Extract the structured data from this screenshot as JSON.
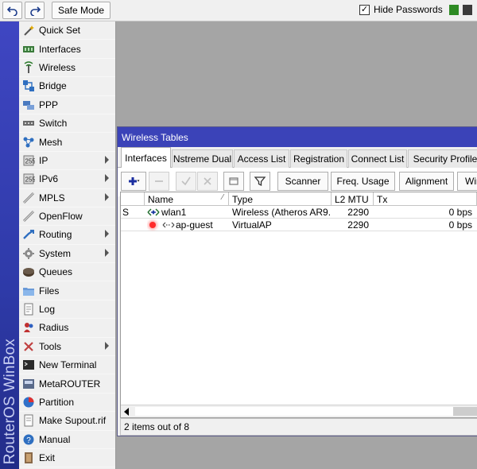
{
  "toolbar": {
    "undo_icon": "undo-icon",
    "redo_icon": "redo-icon",
    "safe_mode_label": "Safe Mode",
    "hide_passwords_label": "Hide Passwords",
    "hide_passwords_checked": "✓",
    "status_colors": [
      "#2e8b24",
      "#3b3b3b"
    ]
  },
  "brand": {
    "text": "RouterOS WinBox",
    "color": "#3b43b8"
  },
  "menu": {
    "items": [
      {
        "label": "Quick Set",
        "icon": "wand-icon",
        "submenu": false
      },
      {
        "label": "Interfaces",
        "icon": "interfaces-icon",
        "submenu": false
      },
      {
        "label": "Wireless",
        "icon": "antenna-icon",
        "submenu": false
      },
      {
        "label": "Bridge",
        "icon": "bridge-icon",
        "submenu": false
      },
      {
        "label": "PPP",
        "icon": "ppp-icon",
        "submenu": false
      },
      {
        "label": "Switch",
        "icon": "switch-icon",
        "submenu": false
      },
      {
        "label": "Mesh",
        "icon": "mesh-icon",
        "submenu": false
      },
      {
        "label": "IP",
        "icon": "ip-icon",
        "submenu": true
      },
      {
        "label": "IPv6",
        "icon": "ipv6-icon",
        "submenu": true
      },
      {
        "label": "MPLS",
        "icon": "mpls-icon",
        "submenu": true
      },
      {
        "label": "OpenFlow",
        "icon": "openflow-icon",
        "submenu": false
      },
      {
        "label": "Routing",
        "icon": "routing-icon",
        "submenu": true
      },
      {
        "label": "System",
        "icon": "gear-icon",
        "submenu": true
      },
      {
        "label": "Queues",
        "icon": "queues-icon",
        "submenu": false
      },
      {
        "label": "Files",
        "icon": "folder-icon",
        "submenu": false
      },
      {
        "label": "Log",
        "icon": "log-icon",
        "submenu": false
      },
      {
        "label": "Radius",
        "icon": "radius-icon",
        "submenu": false
      },
      {
        "label": "Tools",
        "icon": "tools-icon",
        "submenu": true
      },
      {
        "label": "New Terminal",
        "icon": "terminal-icon",
        "submenu": false
      },
      {
        "label": "MetaROUTER",
        "icon": "metarouter-icon",
        "submenu": false
      },
      {
        "label": "Partition",
        "icon": "partition-icon",
        "submenu": false
      },
      {
        "label": "Make Supout.rif",
        "icon": "supout-icon",
        "submenu": false
      },
      {
        "label": "Manual",
        "icon": "help-icon",
        "submenu": false
      },
      {
        "label": "Exit",
        "icon": "exit-icon",
        "submenu": false
      }
    ]
  },
  "window": {
    "title": "Wireless Tables",
    "tabs": [
      {
        "label": "Interfaces",
        "active": true
      },
      {
        "label": "Nstreme Dual",
        "active": false
      },
      {
        "label": "Access List",
        "active": false
      },
      {
        "label": "Registration",
        "active": false
      },
      {
        "label": "Connect List",
        "active": false
      },
      {
        "label": "Security Profiles",
        "active": false
      }
    ],
    "actions": {
      "add_icon": "plus-icon",
      "remove_icon": "minus-icon",
      "enable_icon": "check-icon",
      "disable_icon": "x-icon",
      "comment_icon": "comment-icon",
      "filter_icon": "filter-icon",
      "scanner_label": "Scanner",
      "freq_usage_label": "Freq. Usage",
      "alignment_label": "Alignment",
      "more_label": "Wir"
    },
    "table": {
      "headers": {
        "flags": "",
        "name": "Name",
        "type": "Type",
        "l2mtu": "L2 MTU",
        "tx": "Tx"
      },
      "rows": [
        {
          "flag": "S",
          "name": "wlan1",
          "type": "Wireless (Atheros AR9...",
          "l2mtu": "2290",
          "tx": "0 bps"
        },
        {
          "flag": "",
          "name": "ap-guest",
          "type": "VirtualAP",
          "l2mtu": "2290",
          "tx": "0 bps"
        }
      ]
    },
    "status": "2 items out of 8"
  }
}
